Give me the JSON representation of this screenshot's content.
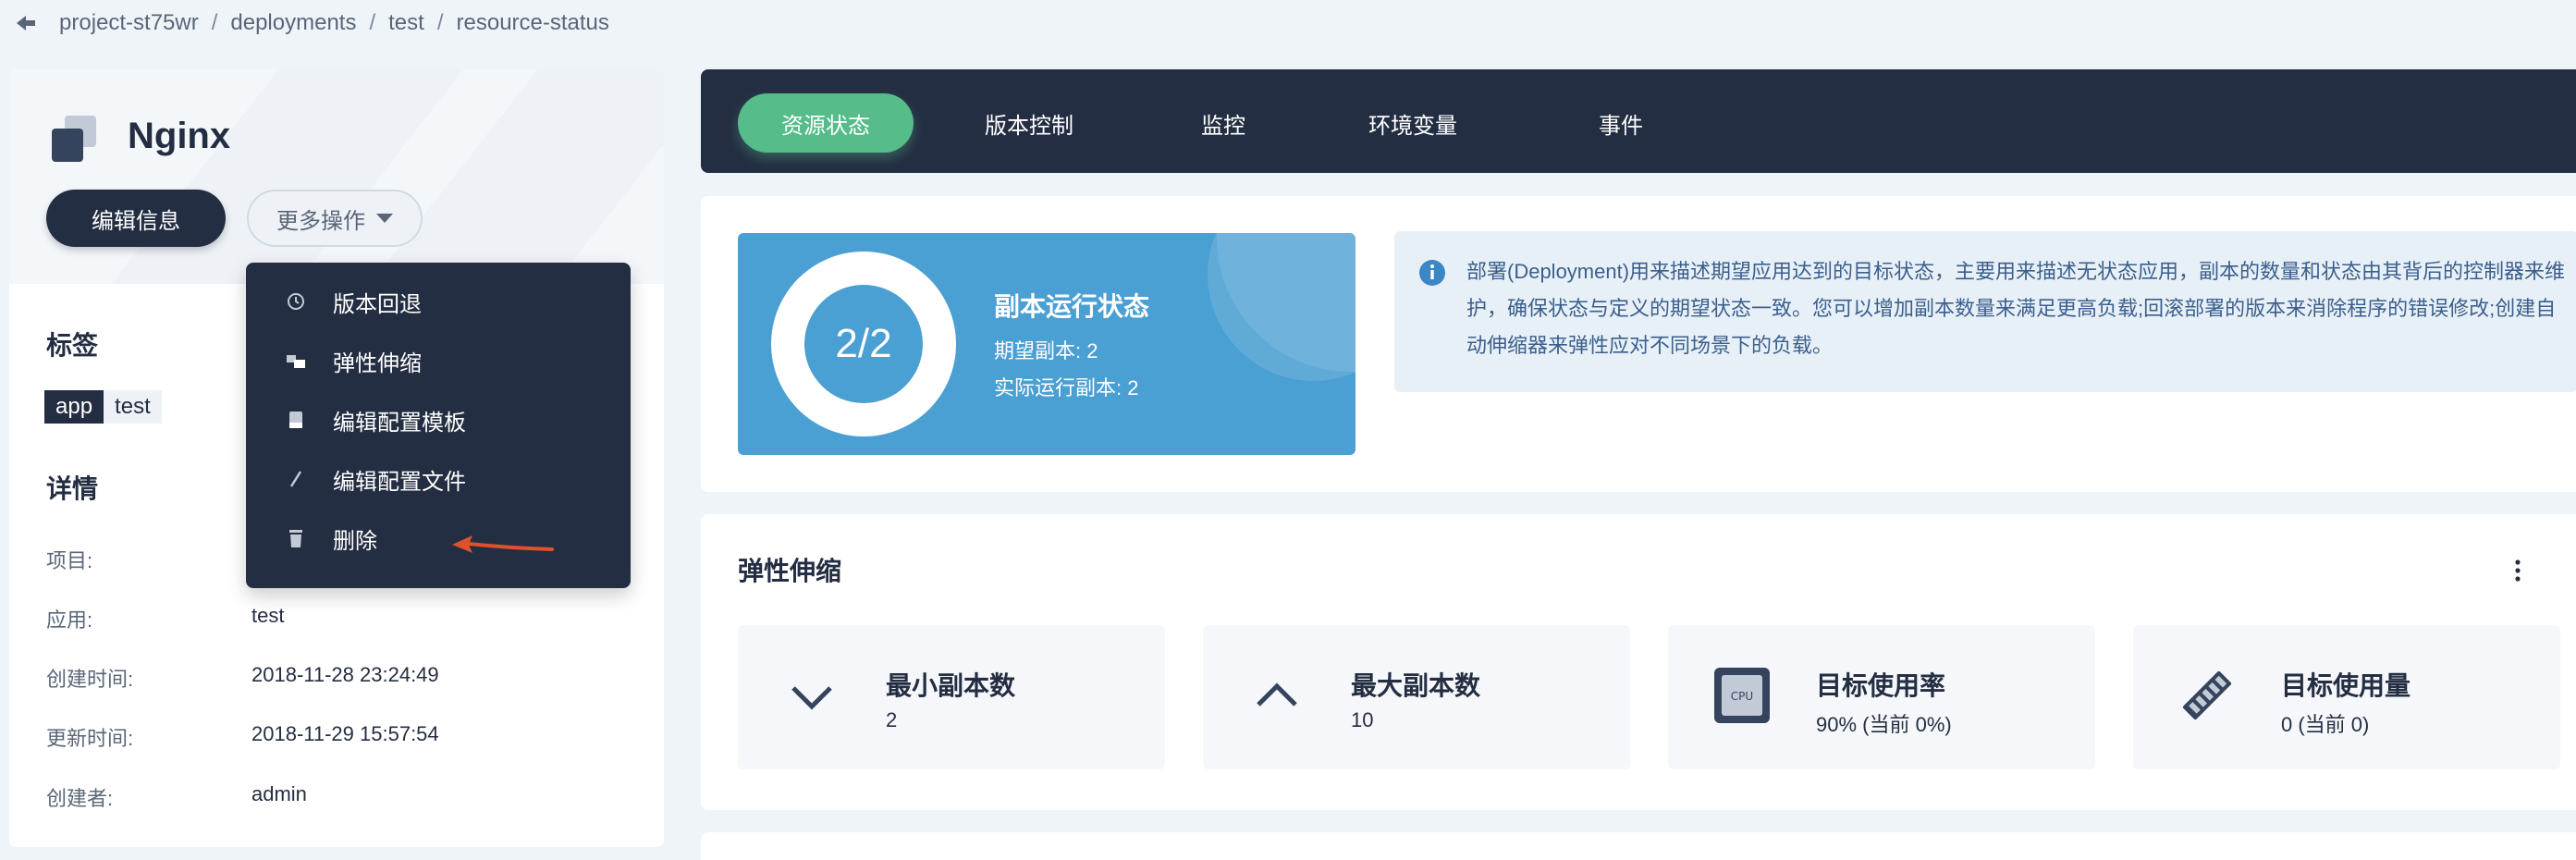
{
  "breadcrumb": [
    "project-st75wr",
    "deployments",
    "test",
    "resource-status"
  ],
  "app": {
    "name": "Nginx"
  },
  "actions": {
    "edit_label": "编辑信息",
    "more_label": "更多操作"
  },
  "more_menu": [
    {
      "icon": "history-icon",
      "label": "版本回退"
    },
    {
      "icon": "scale-icon",
      "label": "弹性伸缩"
    },
    {
      "icon": "template-icon",
      "label": "编辑配置模板"
    },
    {
      "icon": "pencil-icon",
      "label": "编辑配置文件"
    },
    {
      "icon": "trash-icon",
      "label": "删除"
    }
  ],
  "labels_section": {
    "title": "标签",
    "tag_key": "app",
    "tag_value": "test"
  },
  "details": {
    "title": "详情",
    "rows": [
      {
        "key": "项目:",
        "value": ""
      },
      {
        "key": "应用:",
        "value": "test"
      },
      {
        "key": "创建时间:",
        "value": "2018-11-28 23:24:49"
      },
      {
        "key": "更新时间:",
        "value": "2018-11-29 15:57:54"
      },
      {
        "key": "创建者:",
        "value": "admin"
      }
    ]
  },
  "tabs": [
    "资源状态",
    "版本控制",
    "监控",
    "环境变量",
    "事件"
  ],
  "active_tab": 0,
  "replica_status": {
    "ratio": "2/2",
    "title": "副本运行状态",
    "desired": "期望副本: 2",
    "actual": "实际运行副本: 2"
  },
  "info_text": "部署(Deployment)用来描述期望应用达到的目标状态，主要用来描述无状态应用，副本的数量和状态由其背后的控制器来维护，确保状态与定义的期望状态一致。您可以增加副本数量来满足更高负载;回滚部署的版本来消除程序的错误修改;创建自动伸缩器来弹性应对不同场景下的负载。",
  "autoscale": {
    "title": "弹性伸缩",
    "metrics": [
      {
        "icon": "chevron-down-icon",
        "label": "最小副本数",
        "value": "2"
      },
      {
        "icon": "chevron-up-icon",
        "label": "最大副本数",
        "value": "10"
      },
      {
        "icon": "cpu-icon",
        "label": "目标使用率",
        "value": "90% (当前 0%)"
      },
      {
        "icon": "memory-icon",
        "label": "目标使用量",
        "value": "0 (当前 0)"
      }
    ]
  },
  "colors": {
    "dark": "#242e42",
    "green": "#55bc8a",
    "blue": "#4a9fd3",
    "arrow": "#e0512b"
  }
}
